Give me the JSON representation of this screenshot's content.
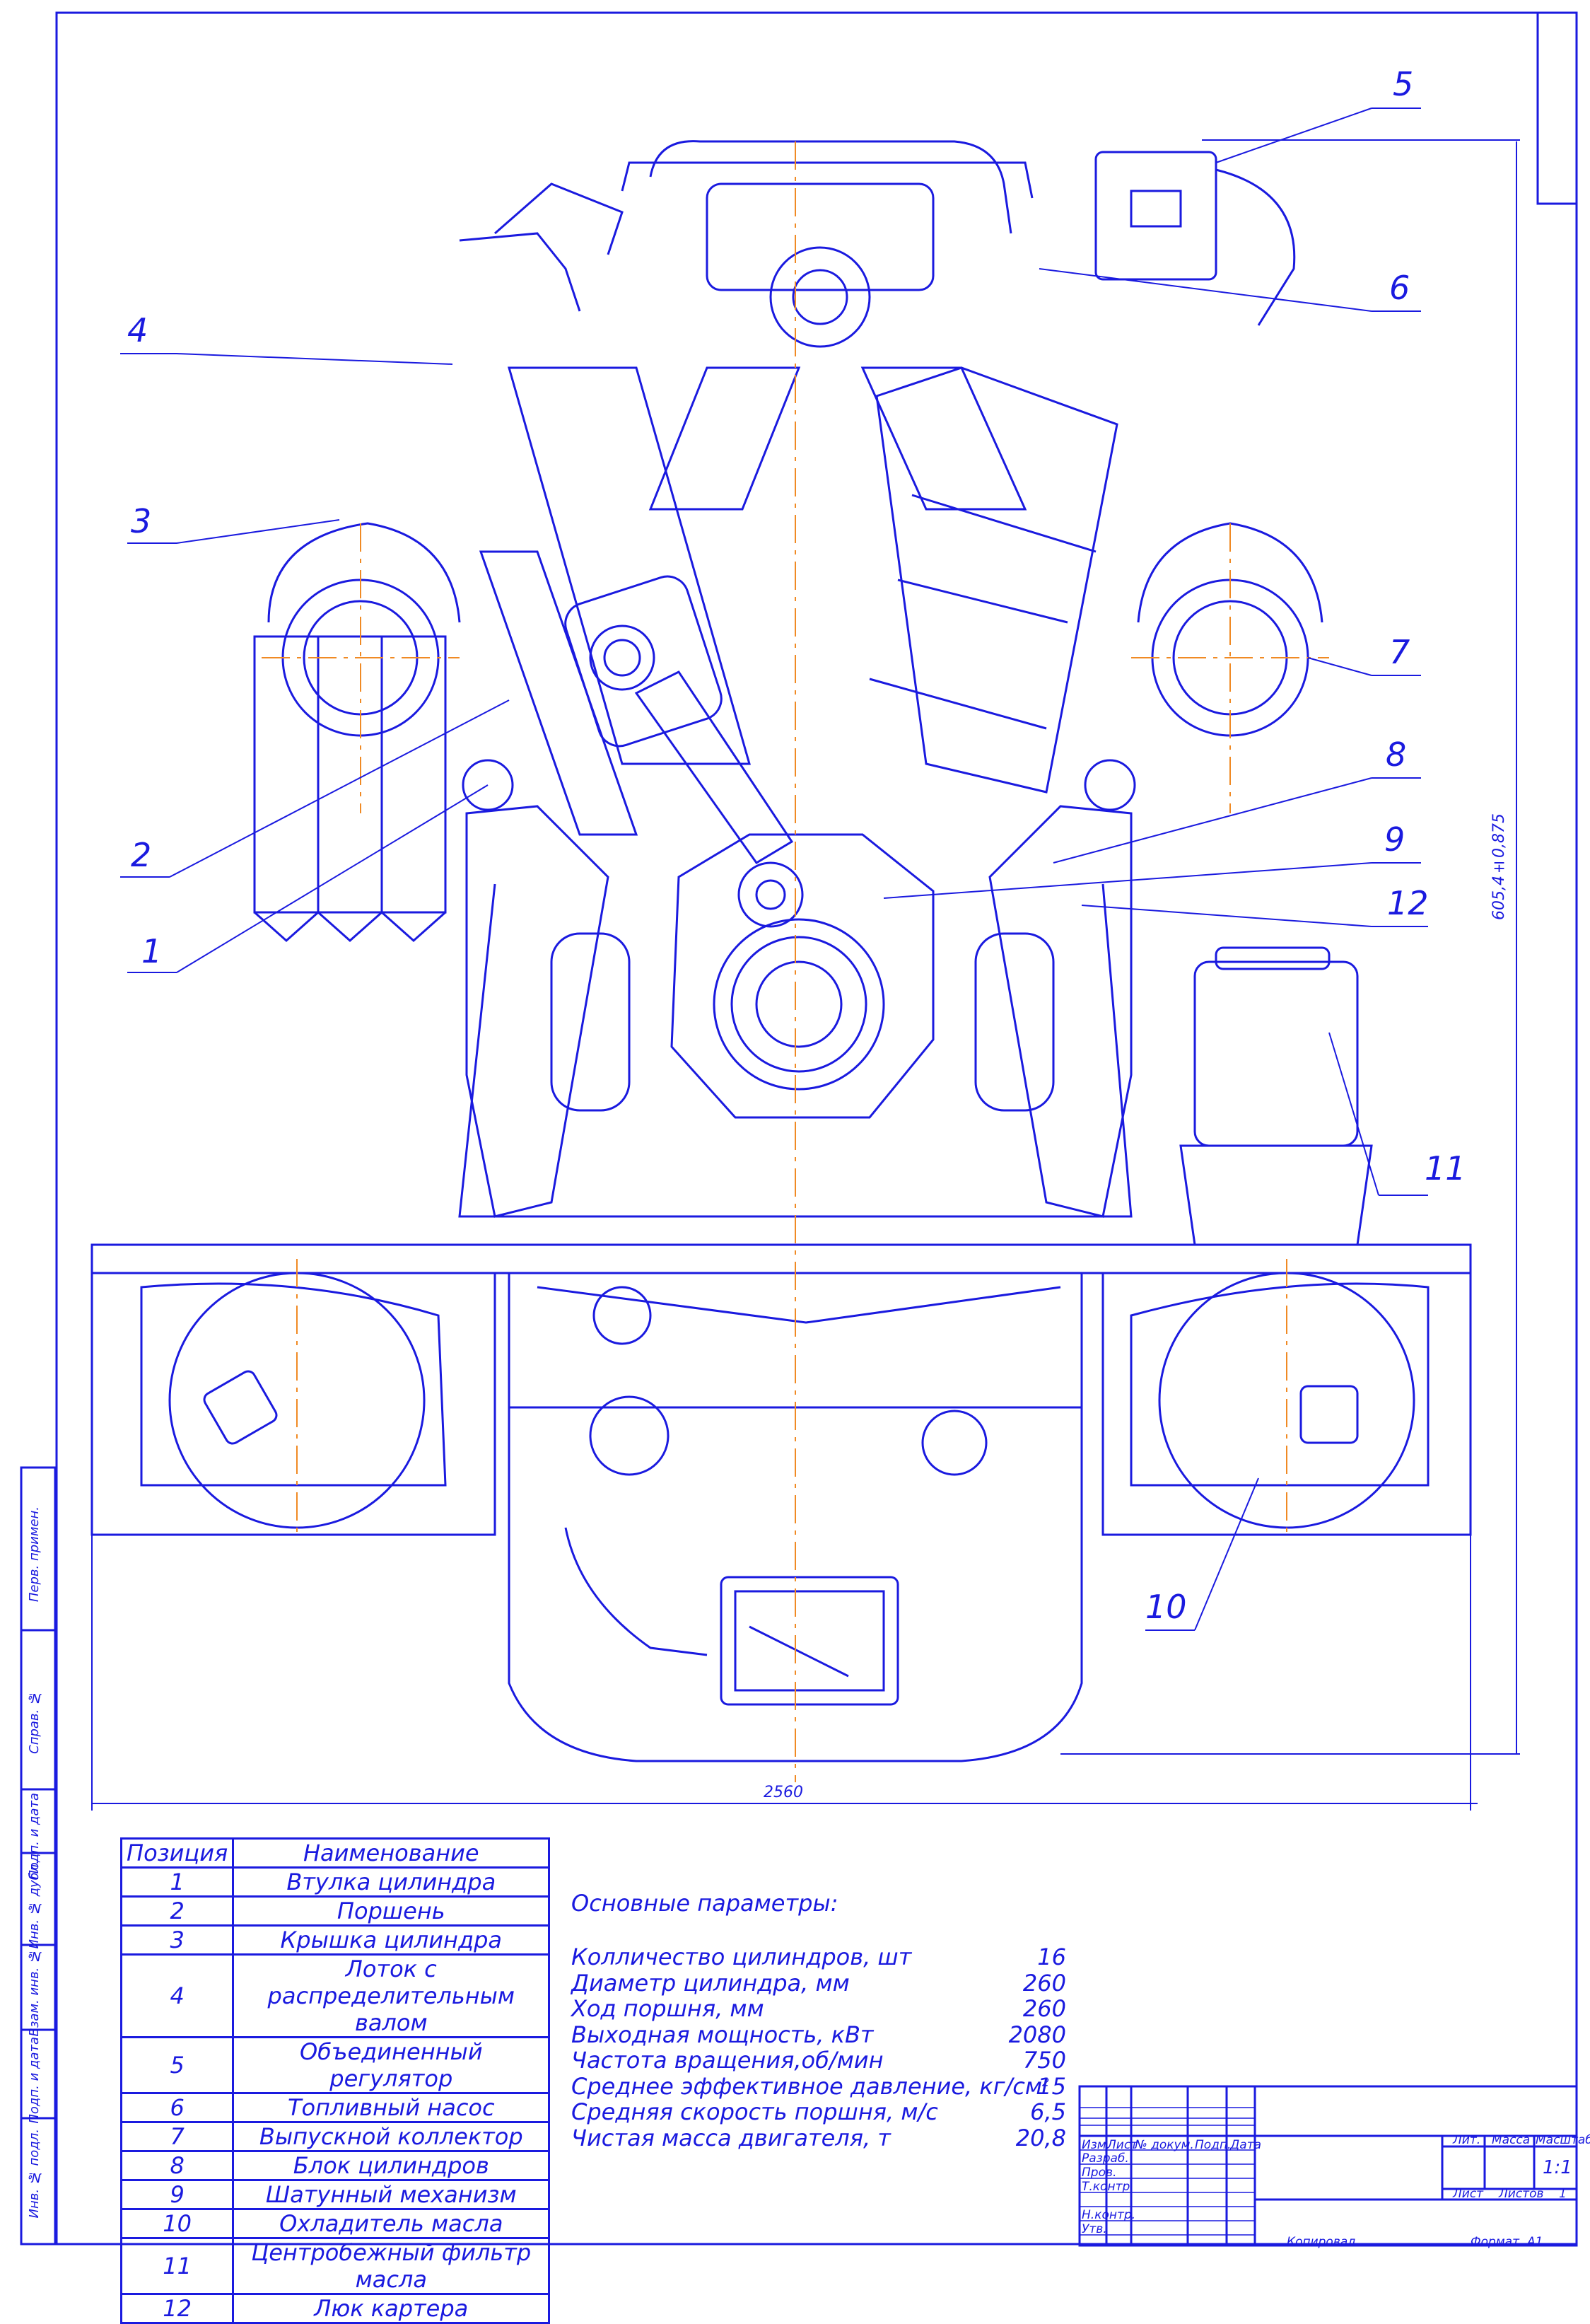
{
  "drawing": {
    "callouts": [
      "1",
      "2",
      "3",
      "4",
      "5",
      "6",
      "7",
      "8",
      "9",
      "10",
      "11",
      "12"
    ],
    "dimension_vertical": "605,4±0,875",
    "dimension_horizontal": "2560"
  },
  "spec_table": {
    "header_pos": "Позиция",
    "header_name": "Наименование",
    "rows": [
      {
        "pos": "1",
        "name": "Втулка цилиндра"
      },
      {
        "pos": "2",
        "name": "Поршень"
      },
      {
        "pos": "3",
        "name": "Крышка цилиндра"
      },
      {
        "pos": "4",
        "name": "Лоток с распределительным валом"
      },
      {
        "pos": "5",
        "name": "Объединенный регулятор"
      },
      {
        "pos": "6",
        "name": "Топливный насос"
      },
      {
        "pos": "7",
        "name": "Выпускной коллектор"
      },
      {
        "pos": "8",
        "name": "Блок цилиндров"
      },
      {
        "pos": "9",
        "name": "Шатунный механизм"
      },
      {
        "pos": "10",
        "name": "Охладитель масла"
      },
      {
        "pos": "11",
        "name": "Центробежный фильтр масла"
      },
      {
        "pos": "12",
        "name": "Люк картера"
      }
    ]
  },
  "parameters": {
    "title": "Основные параметры:",
    "rows": [
      {
        "label": "Колличество цилиндров, шт",
        "value": "16"
      },
      {
        "label": "Диаметр цилиндра, мм",
        "value": "260"
      },
      {
        "label": "Ход поршня, мм",
        "value": "260"
      },
      {
        "label": "Выходная мощность, кВт",
        "value": "2080"
      },
      {
        "label": "Частота вращения,об/мин",
        "value": "750"
      },
      {
        "label": "Среднее эффективное давление, кг/см",
        "value": "15"
      },
      {
        "label": "Средняя скорость поршня, м/с",
        "value": "6,5"
      },
      {
        "label": "Чистая масса двигателя, т",
        "value": "20,8"
      }
    ],
    "superscript": "2"
  },
  "side_stamps": [
    "Перв. примен.",
    "Справ. №",
    "Подп. и дата",
    "Инв. № дубл.",
    "Взам. инв. №",
    "Подп. и дата",
    "Инв. № подл."
  ],
  "title_block": {
    "izm": "Изм.",
    "list": "Лист",
    "doc": "№ докум.",
    "podp": "Подп.",
    "data": "Дата",
    "razrab": "Разраб.",
    "prov": "Пров.",
    "tkontr": "Т.контр.",
    "nkontr": "Н.контр.",
    "utv": "Утв.",
    "lit": "Лит.",
    "massa": "Масса",
    "masshtab": "Масштаб",
    "scale_value": "1:1",
    "list_label": "Лист",
    "listov_label": "Листов",
    "listov_value": "1",
    "kopiroval": "Копировал",
    "format": "Формат",
    "format_value": "A1"
  },
  "colors": {
    "line": "#1a1adf",
    "axis": "#f08a24"
  }
}
